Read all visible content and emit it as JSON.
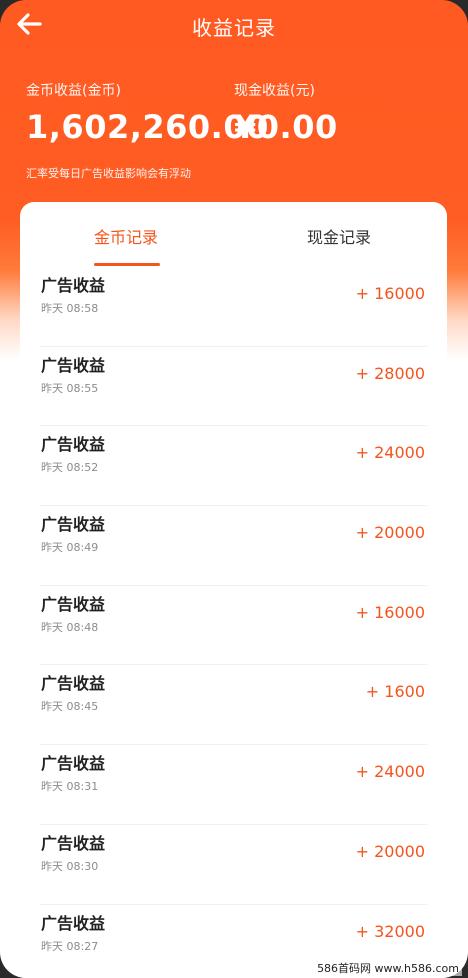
{
  "header": {
    "title": "收益记录"
  },
  "summary": {
    "coin_label": "金币收益(金币)",
    "coin_value": "1,602,260.00",
    "cash_label": "现金收益(元)",
    "cash_value": "¥0.00",
    "note": "汇率受每日广告收益影响会有浮动"
  },
  "tabs": [
    {
      "label": "金币记录",
      "active": true
    },
    {
      "label": "现金记录",
      "active": false
    }
  ],
  "records": [
    {
      "name": "广告收益",
      "time": "昨天 08:58",
      "amount": "+ 16000"
    },
    {
      "name": "广告收益",
      "time": "昨天 08:55",
      "amount": "+ 28000"
    },
    {
      "name": "广告收益",
      "time": "昨天 08:52",
      "amount": "+ 24000"
    },
    {
      "name": "广告收益",
      "time": "昨天 08:49",
      "amount": "+ 20000"
    },
    {
      "name": "广告收益",
      "time": "昨天 08:48",
      "amount": "+ 16000"
    },
    {
      "name": "广告收益",
      "time": "昨天 08:45",
      "amount": "+ 1600"
    },
    {
      "name": "广告收益",
      "time": "昨天 08:31",
      "amount": "+ 24000"
    },
    {
      "name": "广告收益",
      "time": "昨天 08:30",
      "amount": "+ 20000"
    },
    {
      "name": "广告收益",
      "time": "昨天 08:27",
      "amount": "+ 32000"
    }
  ],
  "colors": {
    "accent": "#f4551e",
    "header_bg": "#ff5a22"
  },
  "icons": {
    "back": "arrow-left-icon"
  },
  "watermark": "586首码网 www.h586.com"
}
